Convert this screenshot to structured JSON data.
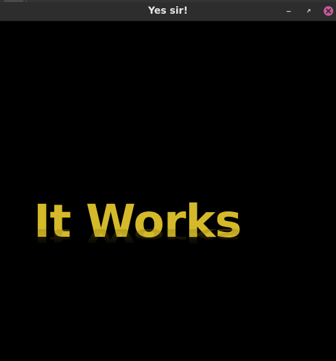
{
  "window": {
    "title": "Yes sir!",
    "controls": {
      "minimize_icon": "minimize-icon",
      "maximize_icon": "maximize-icon",
      "close_icon": "close-icon",
      "close_color": "#c75a9e"
    }
  },
  "content": {
    "hero_text": "It Works",
    "hero_color": "#d4b92a",
    "background": "#000000"
  }
}
